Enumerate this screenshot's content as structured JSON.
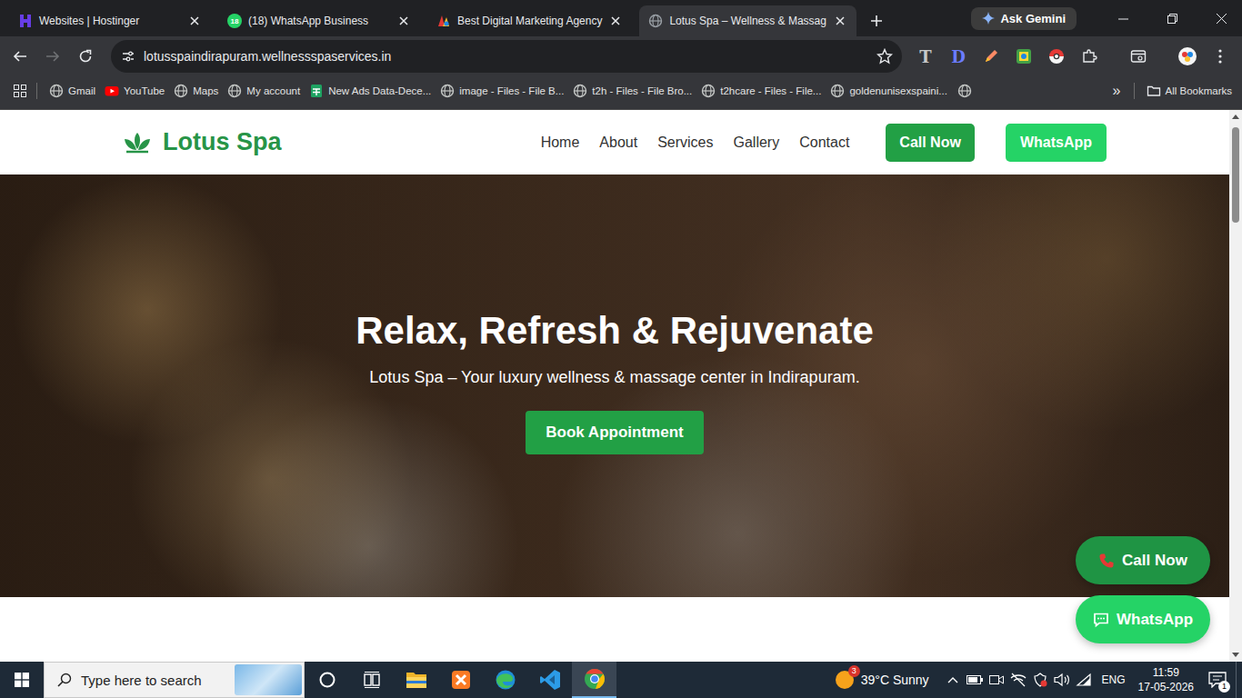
{
  "browser": {
    "tabs": [
      {
        "title": "Websites | Hostinger",
        "kind": "hostinger",
        "selected": false
      },
      {
        "title": "(18) WhatsApp Business",
        "kind": "whatsapp",
        "badge": "18",
        "selected": false
      },
      {
        "title": "Best Digital Marketing Agency",
        "kind": "multicolor",
        "selected": false
      },
      {
        "title": "Lotus Spa – Wellness & Massag",
        "kind": "globe",
        "selected": true
      }
    ],
    "gemini": "Ask Gemini",
    "url": "lotusspaindirapuram.wellnessspaservices.in",
    "extensions": [
      {
        "kind": "letter",
        "label": "T",
        "color": "#c8c8c8"
      },
      {
        "kind": "letter",
        "label": "D",
        "color": "#6b7cff"
      },
      {
        "kind": "pen"
      },
      {
        "kind": "palette"
      },
      {
        "kind": "pokeball"
      },
      {
        "kind": "puzzle"
      }
    ],
    "bookmarks": [
      {
        "label": "Gmail",
        "kind": "globe"
      },
      {
        "label": "YouTube",
        "kind": "youtube"
      },
      {
        "label": "Maps",
        "kind": "globe"
      },
      {
        "label": "My account",
        "kind": "globe"
      },
      {
        "label": "New Ads Data-Dece...",
        "kind": "sheets"
      },
      {
        "label": "image - Files - File B...",
        "kind": "globe"
      },
      {
        "label": "t2h - Files - File Bro...",
        "kind": "globe"
      },
      {
        "label": "t2hcare - Files - File...",
        "kind": "globe"
      },
      {
        "label": "goldenunisexspaini...",
        "kind": "globe"
      }
    ],
    "bookmarks_more": "»",
    "all_bookmarks": "All Bookmarks"
  },
  "page": {
    "logo": "Lotus Spa",
    "nav": [
      "Home",
      "About",
      "Services",
      "Gallery",
      "Contact"
    ],
    "call_button": "Call Now",
    "whatsapp_button": "WhatsApp",
    "hero": {
      "title": "Relax, Refresh & Rejuvenate",
      "subtitle": "Lotus Spa – Your luxury wellness & massage center in Indirapuram.",
      "button": "Book Appointment"
    },
    "floating": [
      {
        "label": "Call Now",
        "kind": "call"
      },
      {
        "label": "WhatsApp",
        "kind": "whatsapp"
      }
    ]
  },
  "taskbar": {
    "search_placeholder": "Type here to search",
    "apps": [
      {
        "kind": "cortana",
        "selected": false
      },
      {
        "kind": "task-view",
        "selected": false
      },
      {
        "kind": "explorer",
        "selected": false
      },
      {
        "kind": "xampp",
        "selected": false
      },
      {
        "kind": "edge",
        "selected": false
      },
      {
        "kind": "vscode",
        "selected": false
      },
      {
        "kind": "chrome",
        "selected": true
      }
    ],
    "weather": {
      "badge": "3",
      "text": "39°C Sunny"
    },
    "language": "ENG",
    "time": "11:59",
    "date": "17-05-2026",
    "notifications": "1"
  }
}
